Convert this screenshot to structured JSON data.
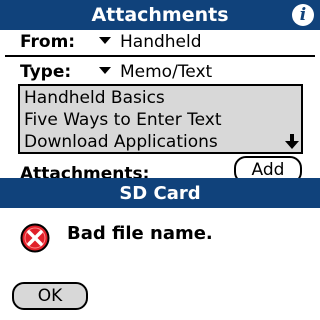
{
  "screen": {
    "title": "Attachments",
    "info_icon": "info-icon",
    "from": {
      "label": "From:",
      "value": "Handheld"
    },
    "type": {
      "label": "Type:",
      "value": "Memo/Text"
    },
    "list_items": [
      "Handheld Basics",
      "Five Ways to Enter Text",
      "Download Applications"
    ],
    "attachments_label": "Attachments:",
    "add_label": "Add"
  },
  "dialog": {
    "title": "SD Card",
    "icon": "error-icon",
    "message": "Bad file name.",
    "ok_label": "OK"
  },
  "colors": {
    "title_bar": "#10427b",
    "list_background": "#d8d8d8",
    "error_red": "#e0202a"
  }
}
